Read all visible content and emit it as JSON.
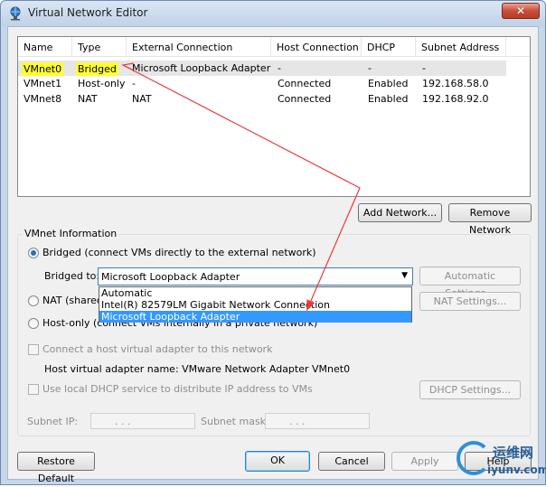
{
  "window": {
    "title": "Virtual Network Editor",
    "close_glyph": "✕"
  },
  "table": {
    "headers": [
      "Name",
      "Type",
      "External Connection",
      "Host Connection",
      "DHCP",
      "Subnet Address"
    ],
    "rows": [
      [
        "VMnet0",
        "Bridged",
        "Microsoft Loopback Adapter",
        "-",
        "-",
        "-"
      ],
      [
        "VMnet1",
        "Host-only",
        "-",
        "Connected",
        "Enabled",
        "192.168.58.0"
      ],
      [
        "VMnet8",
        "NAT",
        "NAT",
        "Connected",
        "Enabled",
        "192.168.92.0"
      ]
    ],
    "selected_row": 0,
    "highlight_color": "#ffff33"
  },
  "buttons": {
    "add_network": "Add Network...",
    "remove_network": "Remove Network",
    "automatic_settings": "Automatic Settings...",
    "nat_settings": "NAT Settings...",
    "dhcp_settings": "DHCP Settings...",
    "restore_default": "Restore Default",
    "ok": "OK",
    "cancel": "Cancel",
    "apply": "Apply",
    "help": "Help"
  },
  "vmnet_info": {
    "group_title": "VMnet Information",
    "bridged_label": "Bridged (connect VMs directly to the external network)",
    "bridged_to_label": "Bridged to:",
    "bridged_to_value": "Microsoft Loopback Adapter",
    "nat_label": "NAT (shared",
    "hostonly_label": "Host-only (connect VMs internally in a private network)",
    "connect_host_adapter": "Connect a host virtual adapter to this network",
    "host_adapter_name": "Host virtual adapter name: VMware Network Adapter VMnet0",
    "use_dhcp": "Use local DHCP service to distribute IP address to VMs",
    "subnet_ip_label": "Subnet IP:",
    "subnet_mask_label": "Subnet mask:",
    "ip_placeholder": ".       .       .",
    "selected_mode": "Bridged"
  },
  "dropdown": {
    "options": [
      "Automatic",
      "Intel(R) 82579LM Gigabit Network Connection",
      "Microsoft Loopback Adapter"
    ],
    "selected_index": 2
  },
  "watermark": {
    "text_cn": "运维网",
    "url": "iyunv.com"
  },
  "colors": {
    "annotation": "#e83a3a",
    "selection": "#3399ff",
    "accent": "#3c7fb1"
  }
}
